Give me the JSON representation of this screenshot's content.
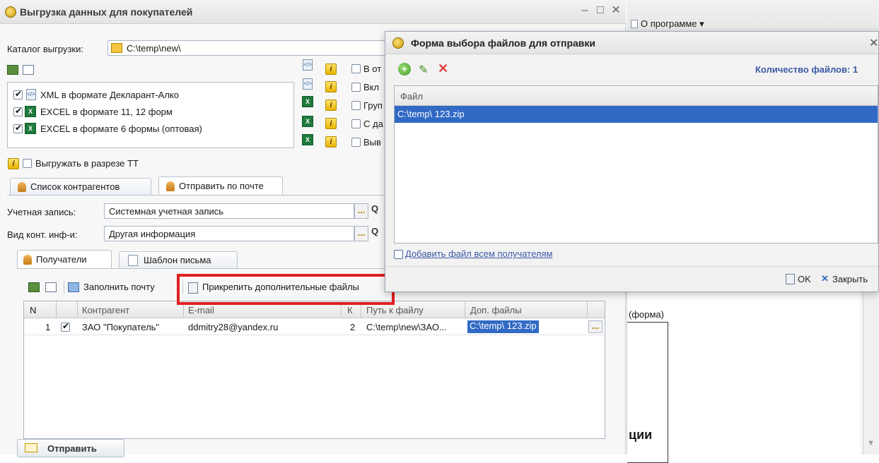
{
  "main_window": {
    "title": "Выгрузка данных для покупателей",
    "catalog_label": "Каталог выгрузки:",
    "catalog_value": "C:\\temp\\new\\",
    "formats": [
      {
        "label": "XML в формате Декларант-Алко",
        "checked": true
      },
      {
        "label": "EXCEL в формате 11, 12 форм",
        "checked": true
      },
      {
        "label": "EXCEL в формате 6 формы (оптовая)",
        "checked": true
      }
    ],
    "options": [
      {
        "label": "В от",
        "checked": false
      },
      {
        "label": "Вкл",
        "checked": false
      },
      {
        "label": "Груп",
        "checked": false
      },
      {
        "label": "С да",
        "checked": false
      },
      {
        "label": "Выв",
        "checked": false
      }
    ],
    "tt_checkbox": "Выгружать в разрезе ТТ",
    "tabs": [
      "Список контрагентов",
      "Отправить по почте"
    ],
    "account_label": "Учетная запись:",
    "account_value": "Системная учетная запись",
    "contact_label": "Вид конт. инф-и:",
    "contact_value": "Другая информация",
    "inner_tabs": [
      "Получатели",
      "Шаблон письма"
    ],
    "toolbar": {
      "fill_mail": "Заполнить почту",
      "attach_files": "Прикрепить дополнительные файлы"
    },
    "table": {
      "headers": [
        "N",
        "",
        "Контрагент",
        "E-mail",
        "К",
        "Путь к файлу",
        "Доп. файлы"
      ],
      "rows": [
        {
          "n": "1",
          "checked": true,
          "contractor": "ЗАО \"Покупатель\"",
          "email": "ddmitry28@yandex.ru",
          "k": "2",
          "path": "C:\\temp\\new\\ЗАО...",
          "extra": "C:\\temp\\ 123.zip"
        }
      ]
    },
    "send_button": "Отправить",
    "ellipsis": "...",
    "search_glyph": "Q"
  },
  "right_window": {
    "menu_item": "О программе ▾",
    "form_text": "(форма)",
    "bold_text": "ции"
  },
  "dialog": {
    "title": "Форма выбора файлов для отправки",
    "count_label": "Количество файлов: 1",
    "column_header": "Файл",
    "files": [
      "C:\\temp\\ 123.zip"
    ],
    "add_to_all": "Добавить файл всем получателям",
    "ok_button": "OK",
    "close_button": "Закрыть"
  },
  "colors": {
    "accent_blue": "#316ac5",
    "highlight_red": "#e02020",
    "count_blue": "#3b5aa6"
  }
}
